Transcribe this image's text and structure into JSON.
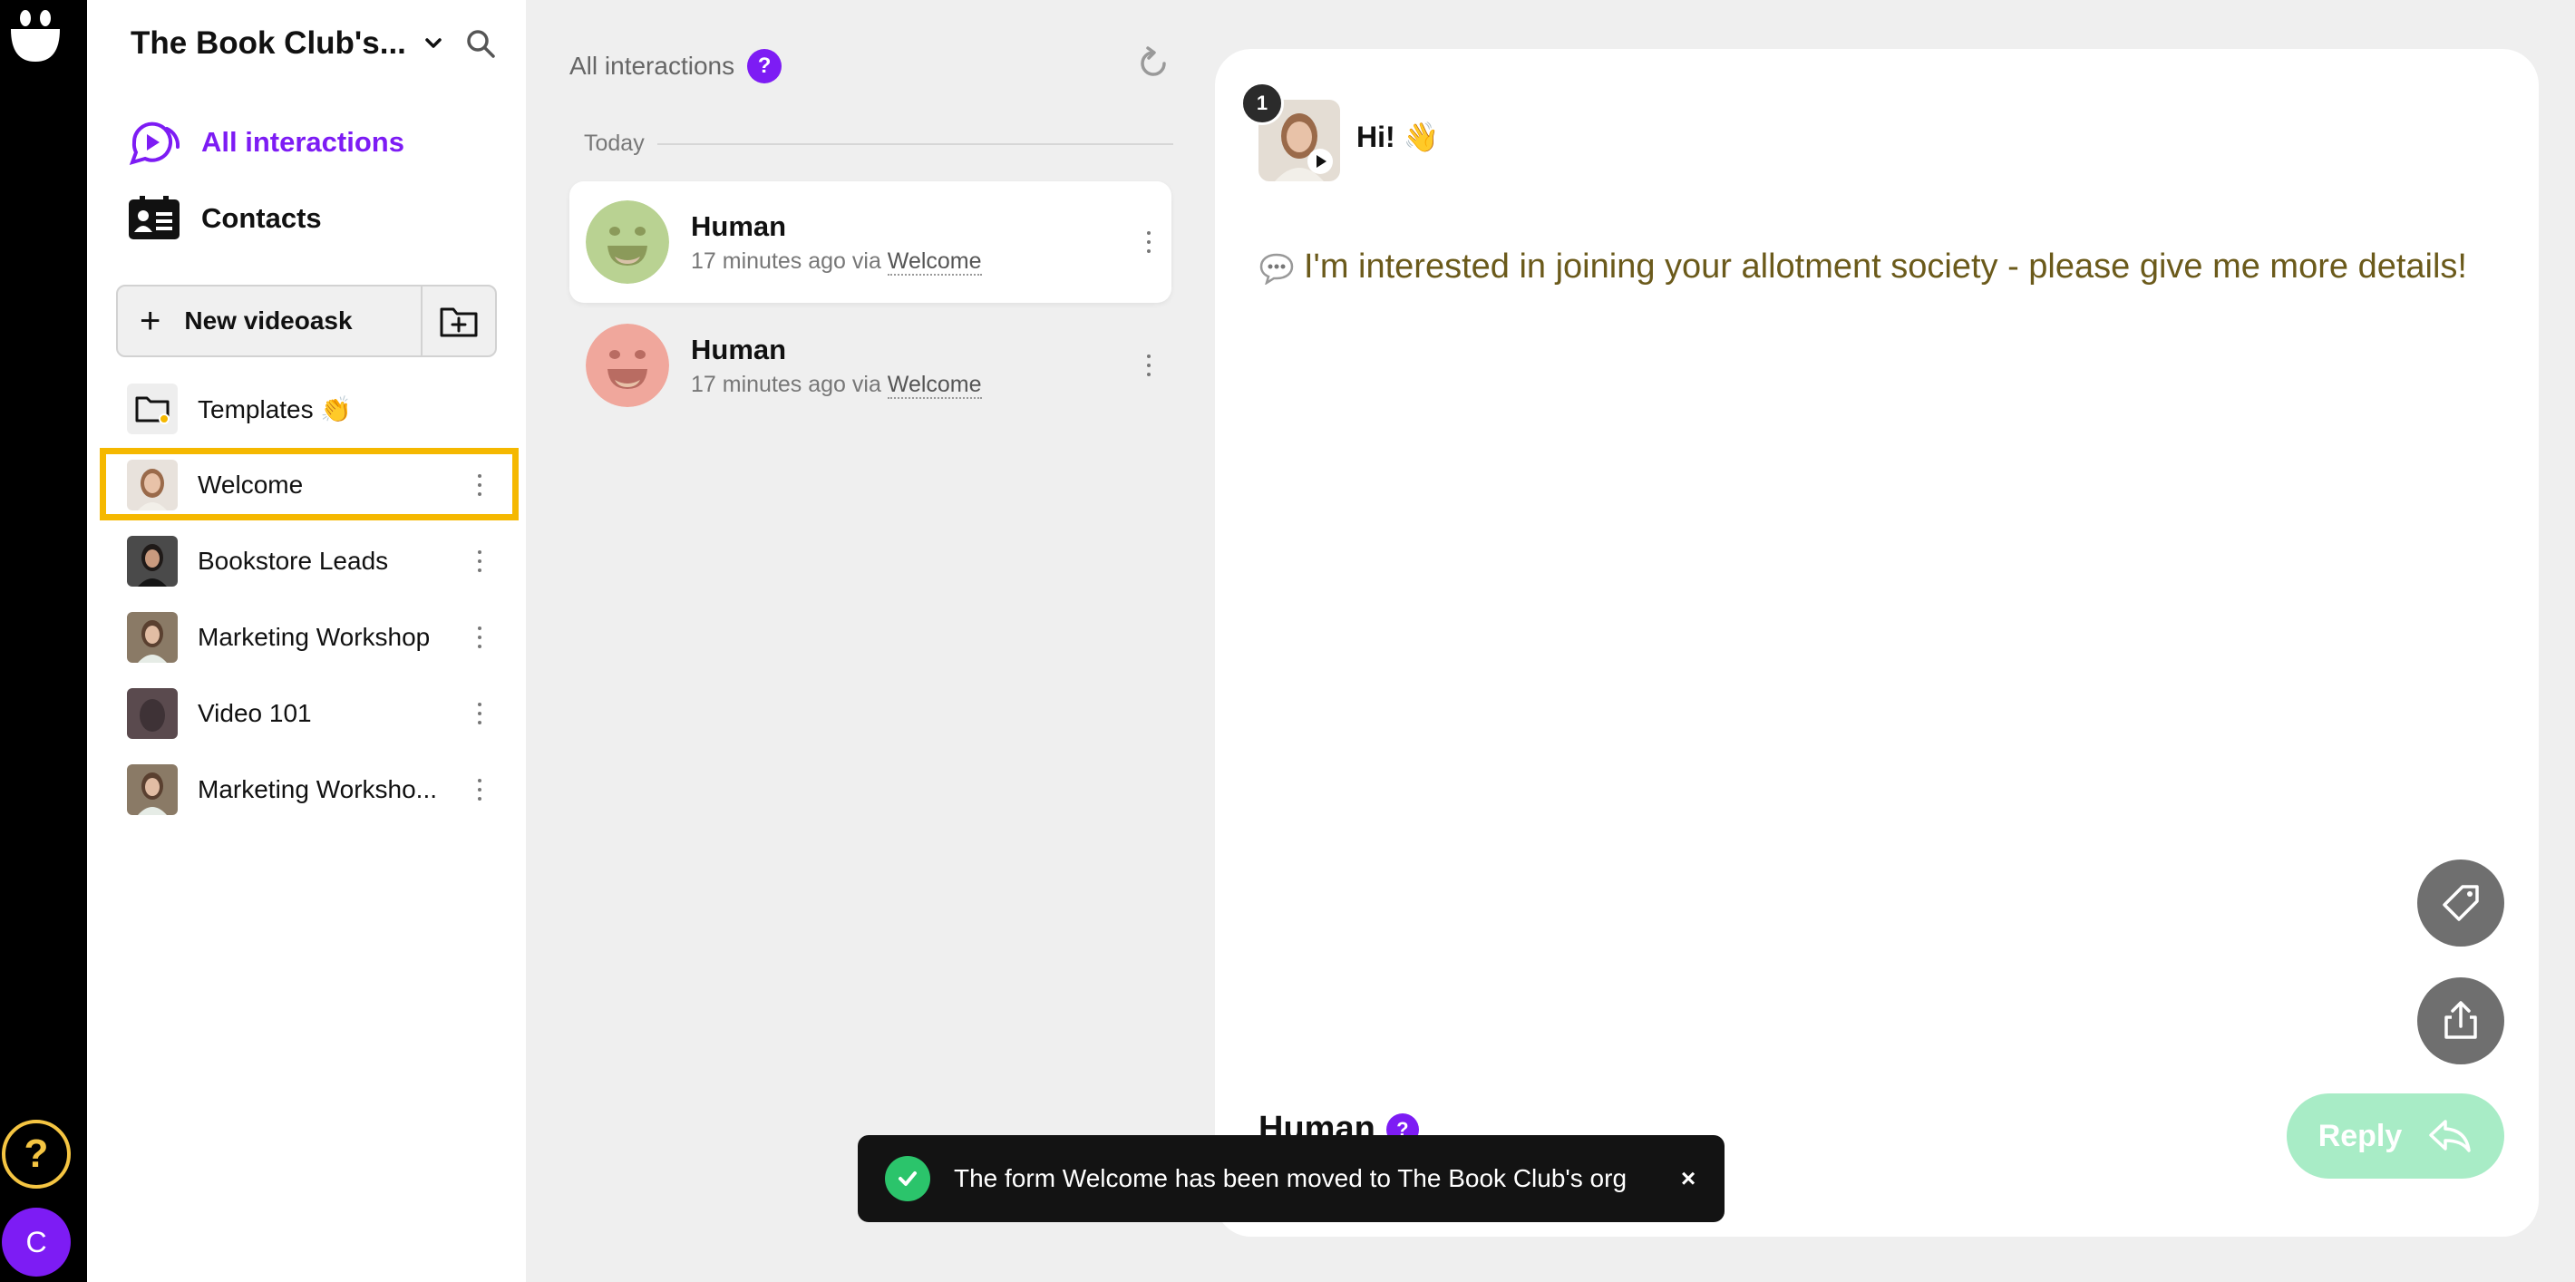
{
  "sidebar": {
    "org_name": "The Book Club's...",
    "nav": {
      "all_interactions": "All interactions",
      "contacts": "Contacts"
    },
    "new_videoask_label": "New videoask",
    "forms": [
      {
        "label": "Templates 👏"
      },
      {
        "label": "Welcome"
      },
      {
        "label": "Bookstore Leads"
      },
      {
        "label": "Marketing Workshop"
      },
      {
        "label": "Video 101"
      },
      {
        "label": "Marketing Worksho..."
      }
    ]
  },
  "rail": {
    "help_label": "?",
    "avatar_initial": "C"
  },
  "list": {
    "title": "All interactions",
    "help_badge": "?",
    "day_label": "Today",
    "items": [
      {
        "name": "Human",
        "time": "17 minutes ago via ",
        "form": "Welcome",
        "face_color": "#b9d292",
        "face_feature": "#8b9a5a"
      },
      {
        "name": "Human",
        "time": "17 minutes ago via ",
        "form": "Welcome",
        "face_color": "#f0a79c",
        "face_feature": "#b96c62"
      }
    ]
  },
  "detail": {
    "step_number": "1",
    "message_title": "Hi! 👋",
    "answer_text": "I'm interested in joining your allotment society - please give me more details!",
    "respondent_name": "Human",
    "respondent_badge": "?",
    "reply_label": "Reply"
  },
  "toast": {
    "text": "The form Welcome has been moved to The Book Club's org",
    "close_label": "×"
  },
  "colors": {
    "accent": "#7d1cf4",
    "selection": "#f5b800",
    "reply": "#a8ecc6",
    "success": "#2bc46b",
    "answer_text": "#6b5a1b"
  }
}
